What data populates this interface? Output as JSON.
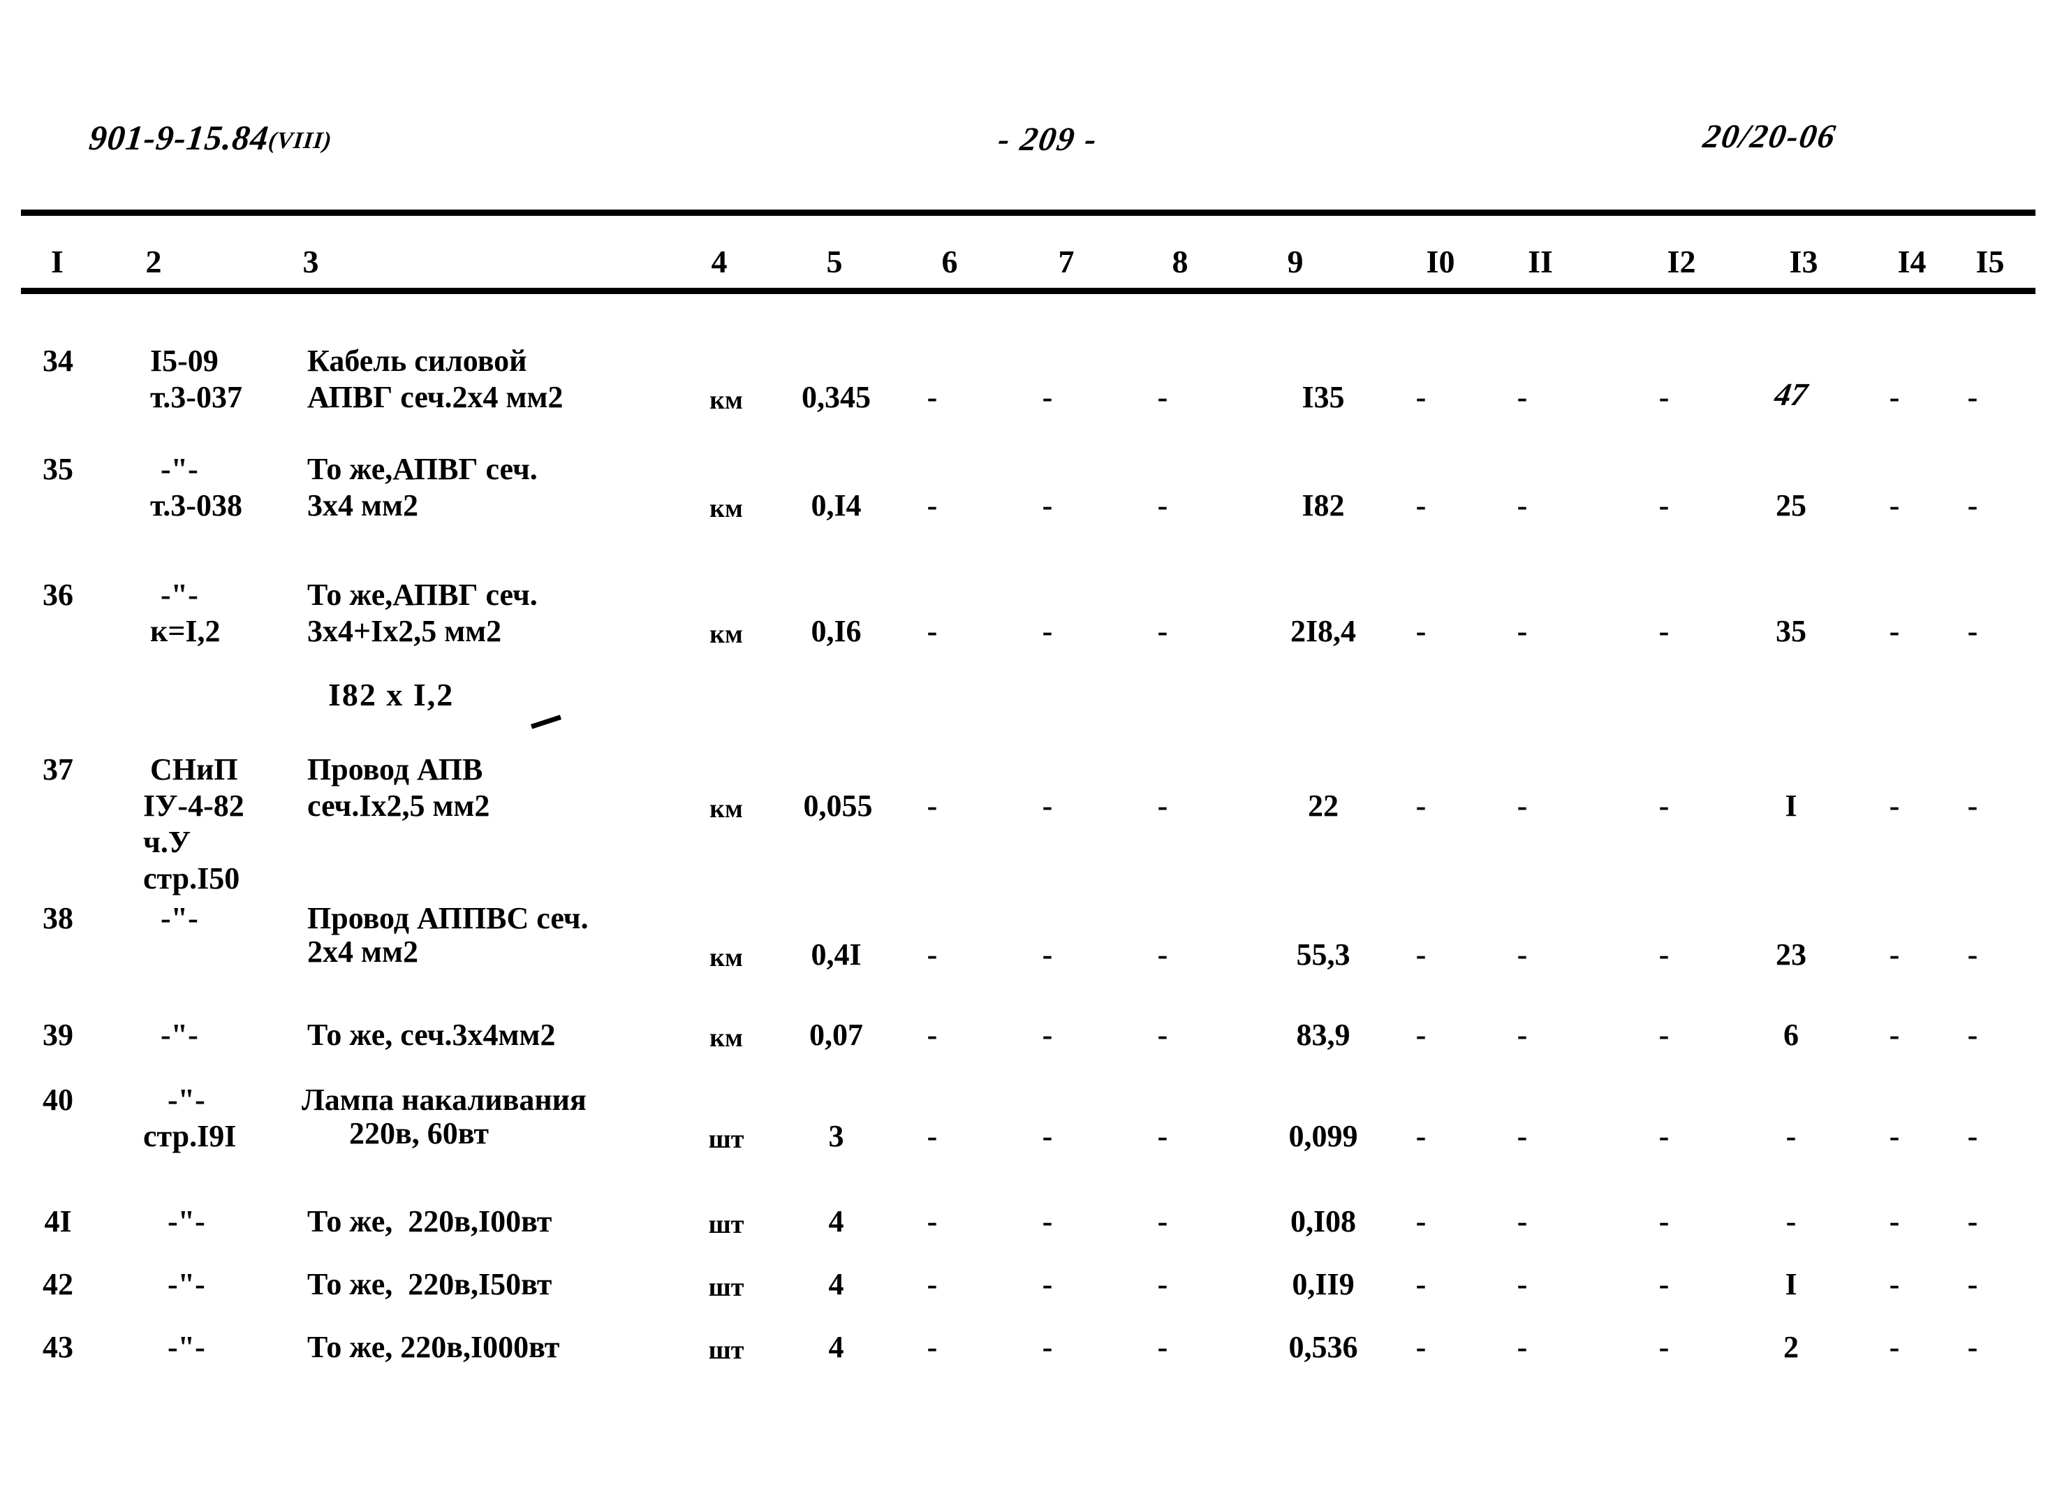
{
  "header": {
    "doc_code": "901-9-15.84",
    "doc_code_roman": "(VIII)",
    "page_number": "- 209 -",
    "sheet_code": "20/20-06"
  },
  "table": {
    "column_headers": [
      "I",
      "2",
      "3",
      "4",
      "5",
      "6",
      "7",
      "8",
      "9",
      "I0",
      "II",
      "I2",
      "I3",
      "I4",
      "I5"
    ],
    "annotation": "I82 x I,2",
    "rows": [
      {
        "num": "34",
        "ref_line1": "I5-09",
        "ref_line2": "т.3-037",
        "ref_line3": "",
        "ref_line4": "",
        "name_line1": "Кабель силовой",
        "name_line2": "АПВГ сеч.2х4 мм2",
        "unit": "км",
        "c5": "0,345",
        "c6": "-",
        "c7": "-",
        "c8": "-",
        "c9": "I35",
        "c10": "-",
        "c11": "-",
        "c12": "-",
        "c13": "47",
        "c13_hand": true,
        "c14": "-",
        "c15": "-"
      },
      {
        "num": "35",
        "ref_line1": "-\"-",
        "ref_line2": "т.3-038",
        "ref_line3": "",
        "ref_line4": "",
        "name_line1": "То же,АПВГ сеч.",
        "name_line2": "3х4 мм2",
        "unit": "км",
        "c5": "0,I4",
        "c6": "-",
        "c7": "-",
        "c8": "-",
        "c9": "I82",
        "c10": "-",
        "c11": "-",
        "c12": "-",
        "c13": "25",
        "c13_hand": false,
        "c14": "-",
        "c15": "-"
      },
      {
        "num": "36",
        "ref_line1": "-\"-",
        "ref_line2": "к=I,2",
        "ref_line3": "",
        "ref_line4": "",
        "name_line1": "То же,АПВГ сеч.",
        "name_line2": "3х4+Iх2,5 мм2",
        "unit": "км",
        "c5": "0,I6",
        "c6": "-",
        "c7": "-",
        "c8": "-",
        "c9": "2I8,4",
        "c10": "-",
        "c11": "-",
        "c12": "-",
        "c13": "35",
        "c13_hand": false,
        "c14": "-",
        "c15": "-"
      },
      {
        "num": "37",
        "ref_line1": "СНиП",
        "ref_line2": "IУ-4-82",
        "ref_line3": "ч.У",
        "ref_line4": "стр.I50",
        "name_line1": "Провод АПВ",
        "name_line2": "сеч.Iх2,5 мм2",
        "unit": "км",
        "c5": "0,055",
        "c6": "-",
        "c7": "-",
        "c8": "-",
        "c9": "22",
        "c10": "-",
        "c11": "-",
        "c12": "-",
        "c13": "I",
        "c13_hand": false,
        "c14": "-",
        "c15": "-"
      },
      {
        "num": "38",
        "ref_line1": "-\"-",
        "ref_line2": "",
        "ref_line3": "",
        "ref_line4": "",
        "name_line1": "Провод АППВС сеч.",
        "name_line2": "2х4 мм2",
        "unit": "км",
        "c5": "0,4I",
        "c6": "-",
        "c7": "-",
        "c8": "-",
        "c9": "55,3",
        "c10": "-",
        "c11": "-",
        "c12": "-",
        "c13": "23",
        "c13_hand": false,
        "c14": "-",
        "c15": "-"
      },
      {
        "num": "39",
        "ref_line1": "-\"-",
        "ref_line2": "",
        "ref_line3": "",
        "ref_line4": "",
        "name_line1": "То же, сеч.3х4мм2",
        "name_line2": "",
        "unit": "км",
        "c5": "0,07",
        "c6": "-",
        "c7": "-",
        "c8": "-",
        "c9": "83,9",
        "c10": "-",
        "c11": "-",
        "c12": "-",
        "c13": "6",
        "c13_hand": false,
        "c14": "-",
        "c15": "-"
      },
      {
        "num": "40",
        "ref_line1": "-\"-",
        "ref_line2": "стр.I9I",
        "ref_line3": "",
        "ref_line4": "",
        "name_line1": "Лампа накаливания",
        "name_line2": "220в, 60вт",
        "unit": "шт",
        "c5": "3",
        "c6": "-",
        "c7": "-",
        "c8": "-",
        "c9": "0,099",
        "c10": "-",
        "c11": "-",
        "c12": "-",
        "c13": "-",
        "c13_hand": false,
        "c14": "-",
        "c15": "-"
      },
      {
        "num": "4I",
        "ref_line1": "-\"-",
        "ref_line2": "",
        "ref_line3": "",
        "ref_line4": "",
        "name_line1": "То же,  220в,I00вт",
        "name_line2": "",
        "unit": "шт",
        "c5": "4",
        "c6": "-",
        "c7": "-",
        "c8": "-",
        "c9": "0,I08",
        "c10": "-",
        "c11": "-",
        "c12": "-",
        "c13": "-",
        "c13_hand": false,
        "c14": "-",
        "c15": "-"
      },
      {
        "num": "42",
        "ref_line1": "-\"-",
        "ref_line2": "",
        "ref_line3": "",
        "ref_line4": "",
        "name_line1": "То же,  220в,I50вт",
        "name_line2": "",
        "unit": "шт",
        "c5": "4",
        "c6": "-",
        "c7": "-",
        "c8": "-",
        "c9": "0,II9",
        "c10": "-",
        "c11": "-",
        "c12": "-",
        "c13": "I",
        "c13_hand": false,
        "c14": "-",
        "c15": "-"
      },
      {
        "num": "43",
        "ref_line1": "-\"-",
        "ref_line2": "",
        "ref_line3": "",
        "ref_line4": "",
        "name_line1": "То же, 220в,I000вт",
        "name_line2": "",
        "unit": "шт",
        "c5": "4",
        "c6": "-",
        "c7": "-",
        "c8": "-",
        "c9": "0,536",
        "c10": "-",
        "c11": "-",
        "c12": "-",
        "c13": "2",
        "c13_hand": false,
        "c14": "-",
        "c15": "-"
      }
    ]
  }
}
